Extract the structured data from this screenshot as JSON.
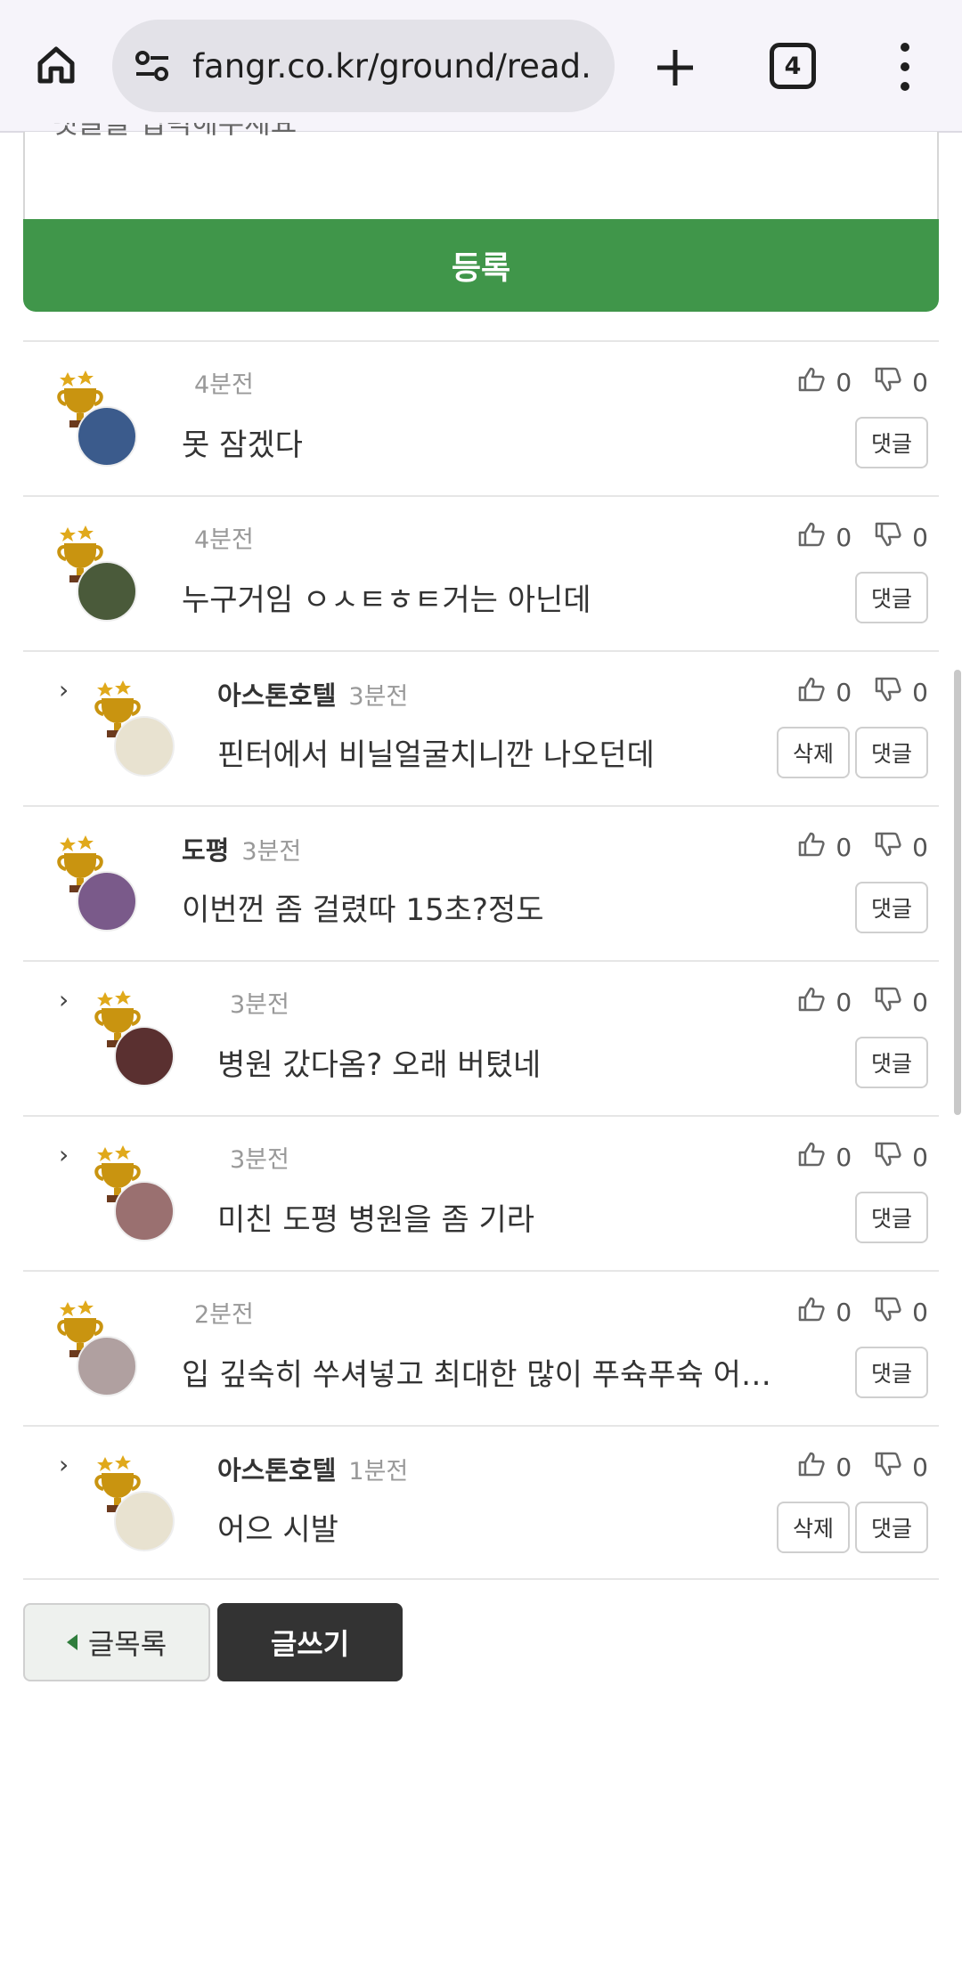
{
  "browser": {
    "url": "fangr.co.kr/ground/read.",
    "tab_count": "4"
  },
  "comment_form": {
    "placeholder": "댓글을 입력해주세요",
    "submit_label": "등록"
  },
  "comments": [
    {
      "nick": "",
      "time": "4분전",
      "text": "못 잠겠다",
      "likes": "0",
      "dislikes": "0",
      "reply_label": "댓글",
      "is_reply": false,
      "is_own": false
    },
    {
      "nick": "",
      "time": "4분전",
      "text": "누구거임 ㅇㅅㅌㅎㅌ거는 아닌데",
      "likes": "0",
      "dislikes": "0",
      "reply_label": "댓글",
      "is_reply": false,
      "is_own": false
    },
    {
      "nick": "아스톤호텔",
      "time": "3분전",
      "text": "핀터에서 비닐얼굴치니깐 나오던데",
      "likes": "0",
      "dislikes": "0",
      "reply_label": "댓글",
      "delete_label": "삭제",
      "is_reply": true,
      "is_own": true
    },
    {
      "nick": "도평",
      "time": "3분전",
      "text": "이번껀 좀 걸렸따 15초?정도",
      "likes": "0",
      "dislikes": "0",
      "reply_label": "댓글",
      "is_reply": false,
      "is_own": false
    },
    {
      "nick": "",
      "time": "3분전",
      "text": "병원 갔다옴? 오래 버텼네",
      "likes": "0",
      "dislikes": "0",
      "reply_label": "댓글",
      "is_reply": true,
      "is_own": false
    },
    {
      "nick": "",
      "time": "3분전",
      "text": "미친 도평 병원을 좀 기라",
      "likes": "0",
      "dislikes": "0",
      "reply_label": "댓글",
      "is_reply": true,
      "is_own": false
    },
    {
      "nick": "",
      "time": "2분전",
      "text": "입 깊숙히 쑤셔넣고 최대한 많이 푸슉푸슉 어흐...",
      "likes": "0",
      "dislikes": "0",
      "reply_label": "댓글",
      "is_reply": false,
      "is_own": false
    },
    {
      "nick": "아스톤호텔",
      "time": "1분전",
      "text": "어으 시발",
      "likes": "0",
      "dislikes": "0",
      "reply_label": "댓글",
      "delete_label": "삭제",
      "is_reply": true,
      "is_own": true
    }
  ],
  "footer": {
    "list_label": "글목록",
    "write_label": "글쓰기"
  },
  "colors": {
    "accent_green": "#40964a",
    "dark_button": "#333333"
  }
}
